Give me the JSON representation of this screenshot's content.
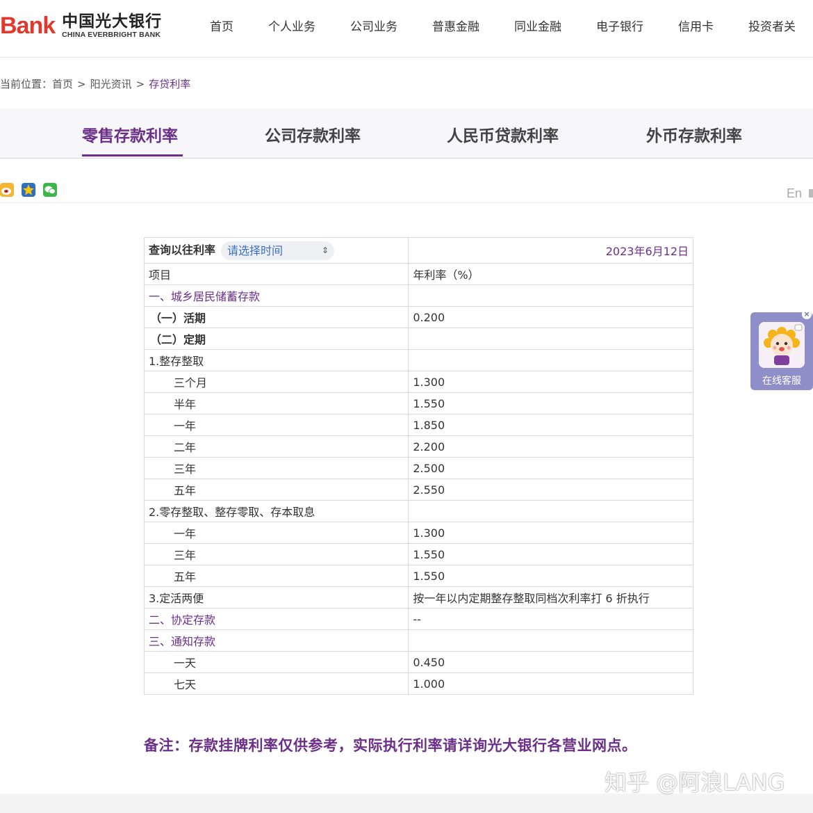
{
  "header": {
    "logo_mark": "Bank",
    "logo_cn": "中国光大银行",
    "logo_en": "CHINA EVERBRIGHT BANK",
    "nav": [
      "首页",
      "个人业务",
      "公司业务",
      "普惠金融",
      "同业金融",
      "电子银行",
      "信用卡",
      "投资者关"
    ]
  },
  "breadcrumb": {
    "prefix": "当前位置：",
    "home": "首页",
    "sep": ">",
    "section": "阳光资讯",
    "current": "存贷利率"
  },
  "tabs": [
    "零售存款利率",
    "公司存款利率",
    "人民币贷款利率",
    "外币存款利率"
  ],
  "share": {
    "icons": [
      "weibo-icon",
      "qzone-icon",
      "wechat-icon"
    ],
    "lang_label": "En"
  },
  "query": {
    "label": "查询以往利率",
    "placeholder": "请选择时间",
    "date": "2023年6月12日"
  },
  "table": {
    "headers": [
      "项目",
      "年利率（%）"
    ],
    "rows": [
      {
        "item": "一、城乡居民储蓄存款",
        "rate": ""
      },
      {
        "item": "（一）活期",
        "rate": "0.200"
      },
      {
        "item": "（二）定期",
        "rate": ""
      },
      {
        "item": "1.整存整取",
        "rate": ""
      },
      {
        "item": "三个月",
        "rate": "1.300"
      },
      {
        "item": "半年",
        "rate": "1.550"
      },
      {
        "item": "一年",
        "rate": "1.850"
      },
      {
        "item": "二年",
        "rate": "2.200"
      },
      {
        "item": "三年",
        "rate": "2.500"
      },
      {
        "item": "五年",
        "rate": "2.550"
      },
      {
        "item": "2.零存整取、整存零取、存本取息",
        "rate": ""
      },
      {
        "item": "一年",
        "rate": "1.300"
      },
      {
        "item": "三年",
        "rate": "1.550"
      },
      {
        "item": "五年",
        "rate": "1.550"
      },
      {
        "item": "3.定活两便",
        "rate": "按一年以内定期整存整取同档次利率打 6 折执行"
      },
      {
        "item": "二、协定存款",
        "rate": "--"
      },
      {
        "item": "三、通知存款",
        "rate": ""
      },
      {
        "item": "一天",
        "rate": "0.450"
      },
      {
        "item": "七天",
        "rate": "1.000"
      }
    ]
  },
  "note": "备注：存款挂牌利率仅供参考，实际执行利率请详询光大银行各营业网点。",
  "chat": {
    "label": "在线客服",
    "close": "×"
  },
  "watermark": "知乎 @阿浪LANG",
  "colors": {
    "accent": "#6b2f8a",
    "selector_text": "#3b6fc4",
    "logo_red": "#e03a2f",
    "chat_bg": "#8e8fc9"
  }
}
